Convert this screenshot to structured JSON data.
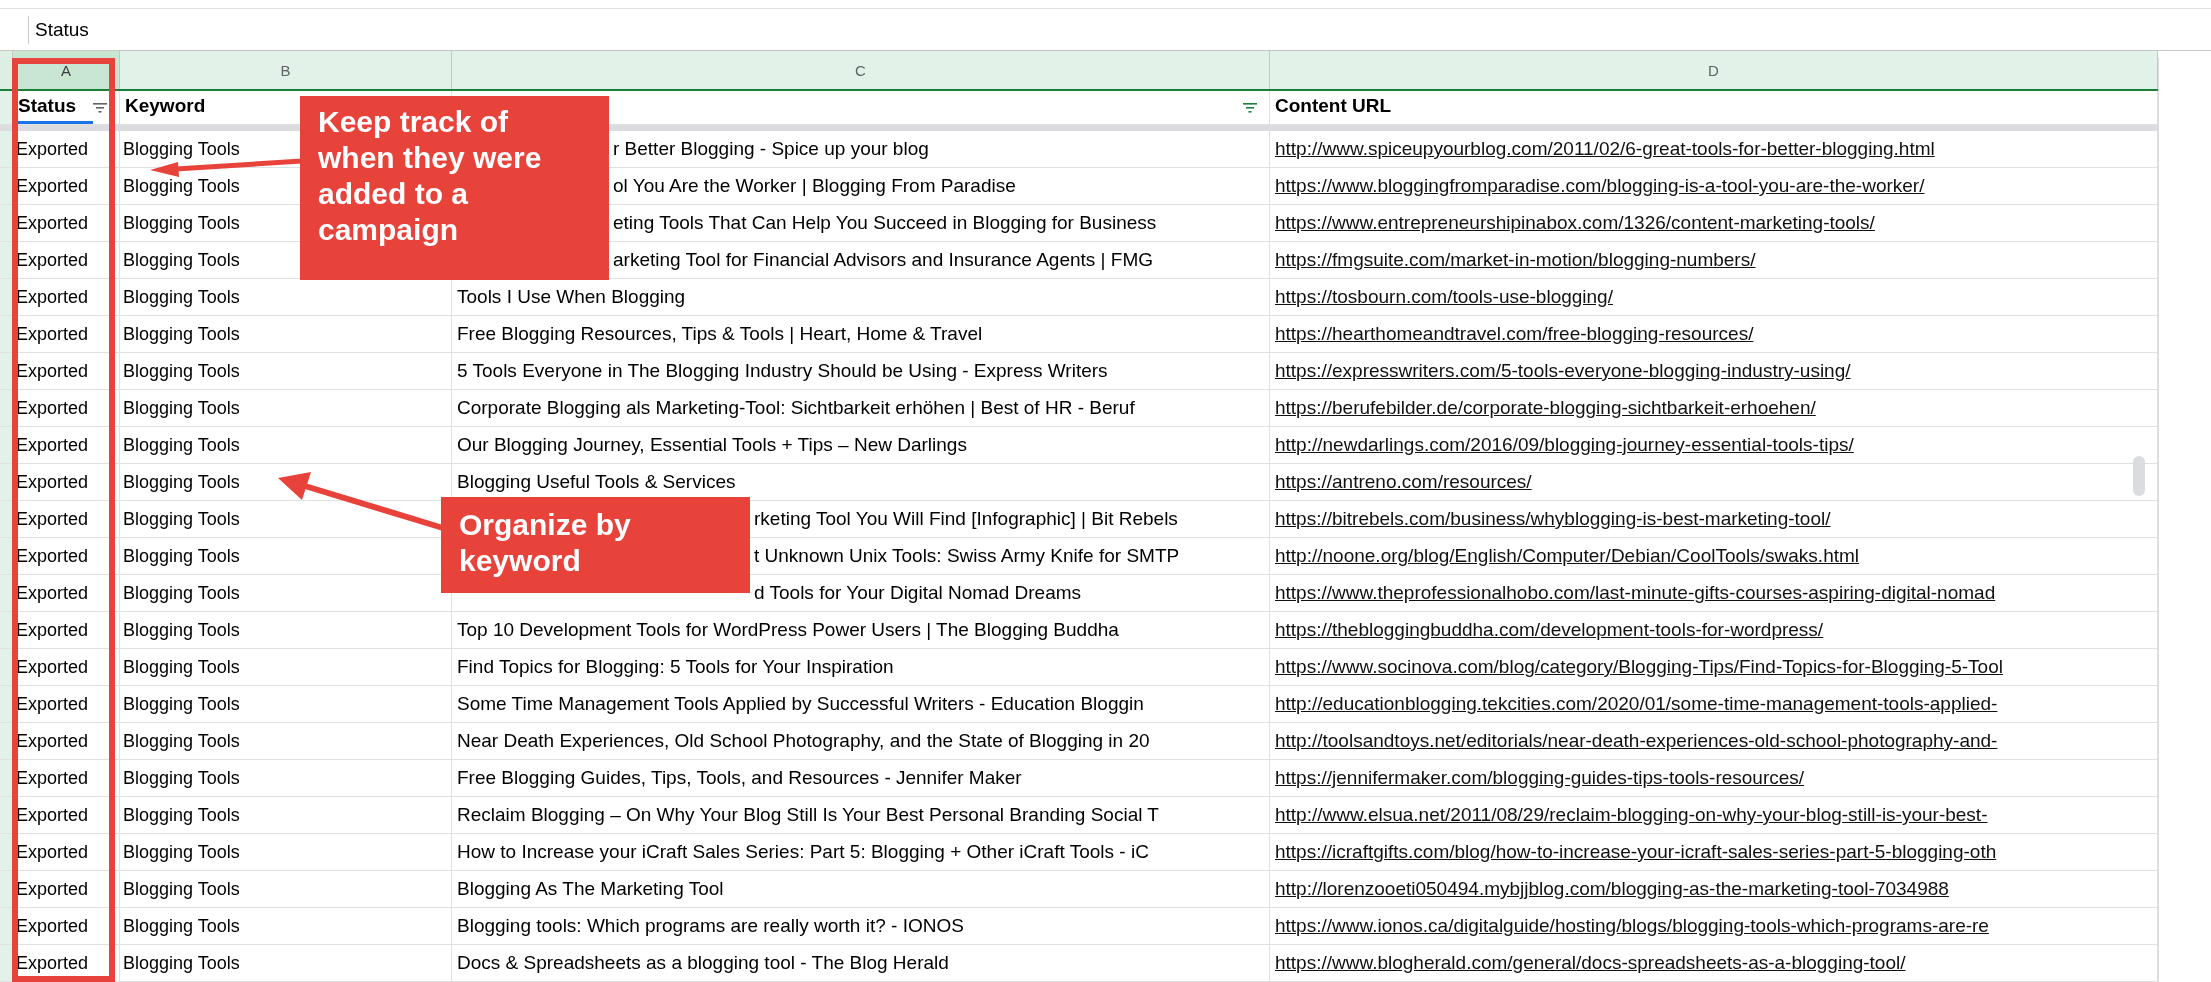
{
  "formula_bar": {
    "value": "Status"
  },
  "columns": [
    {
      "letter": "A",
      "selected": true
    },
    {
      "letter": "B",
      "selected": false
    },
    {
      "letter": "C",
      "selected": false
    },
    {
      "letter": "D",
      "selected": false
    }
  ],
  "header": [
    {
      "text": "Status",
      "filter": true,
      "selected": true
    },
    {
      "text": "Keyword",
      "filter": false,
      "selected": false
    },
    {
      "filter": true,
      "selected": false
    },
    {
      "text": "Content URL",
      "filter": false,
      "selected": false
    }
  ],
  "rows": [
    {
      "status": "Exported",
      "keyword": "Blogging Tools",
      "title": "r Better Blogging - Spice up your blog",
      "title_covered": true,
      "url": "http://www.spiceupyourblog.com/2011/02/6-great-tools-for-better-blogging.html"
    },
    {
      "status": "Exported",
      "keyword": "Blogging Tools",
      "title": "ol You Are the Worker | Blogging From Paradise",
      "title_covered": true,
      "url": "https://www.bloggingfromparadise.com/blogging-is-a-tool-you-are-the-worker/"
    },
    {
      "status": "Exported",
      "keyword": "Blogging Tools",
      "title": "eting Tools That Can Help You Succeed in Blogging for Business",
      "title_covered": true,
      "url": "https://www.entrepreneurshipinabox.com/1326/content-marketing-tools/"
    },
    {
      "status": "Exported",
      "keyword": "Blogging Tools",
      "title": "arketing Tool for Financial Advisors and Insurance Agents | FMG",
      "title_covered": true,
      "url": "https://fmgsuite.com/market-in-motion/blogging-numbers/"
    },
    {
      "status": "Exported",
      "keyword": "Blogging Tools",
      "title": "Tools I Use When Blogging",
      "title_covered": false,
      "url": "https://tosbourn.com/tools-use-blogging/"
    },
    {
      "status": "Exported",
      "keyword": "Blogging Tools",
      "title": "Free Blogging Resources, Tips & Tools | Heart, Home & Travel",
      "title_covered": false,
      "url": "https://hearthomeandtravel.com/free-blogging-resources/"
    },
    {
      "status": "Exported",
      "keyword": "Blogging Tools",
      "title": "5 Tools Everyone in The Blogging Industry Should be Using - Express Writers",
      "title_covered": false,
      "url": "https://expresswriters.com/5-tools-everyone-blogging-industry-using/"
    },
    {
      "status": "Exported",
      "keyword": "Blogging Tools",
      "title": "Corporate Blogging als Marketing-Tool: Sichtbarkeit erhöhen | Best of HR - Beruf",
      "title_covered": false,
      "url": "https://berufebilder.de/corporate-blogging-sichtbarkeit-erhoehen/"
    },
    {
      "status": "Exported",
      "keyword": "Blogging Tools",
      "title": "Our Blogging Journey, Essential Tools + Tips – New Darlings",
      "title_covered": false,
      "url": "http://newdarlings.com/2016/09/blogging-journey-essential-tools-tips/"
    },
    {
      "status": "Exported",
      "keyword": "Blogging Tools",
      "title": "Blogging Useful Tools & Services",
      "title_covered": false,
      "url": "https://antreno.com/resources/"
    },
    {
      "status": "Exported",
      "keyword": "Blogging Tools",
      "title": "rketing Tool You Will Find [Infographic] | Bit Rebels",
      "title_covered": true,
      "url": "https://bitrebels.com/business/whyblogging-is-best-marketing-tool/"
    },
    {
      "status": "Exported",
      "keyword": "Blogging Tools",
      "title": "t Unknown Unix Tools: Swiss Army Knife for SMTP",
      "title_covered": true,
      "url": "http://noone.org/blog/English/Computer/Debian/CoolTools/swaks.html"
    },
    {
      "status": "Exported",
      "keyword": "Blogging Tools",
      "title": "d Tools for Your Digital Nomad Dreams",
      "title_covered": true,
      "url": "https://www.theprofessionalhobo.com/last-minute-gifts-courses-aspiring-digital-nomad"
    },
    {
      "status": "Exported",
      "keyword": "Blogging Tools",
      "title": "Top 10 Development Tools for WordPress Power Users | The Blogging Buddha",
      "title_covered": false,
      "url": "https://thebloggingbuddha.com/development-tools-for-wordpress/"
    },
    {
      "status": "Exported",
      "keyword": "Blogging Tools",
      "title": "Find Topics for Blogging: 5 Tools for Your Inspiration",
      "title_covered": false,
      "url": "https://www.socinova.com/blog/category/Blogging-Tips/Find-Topics-for-Blogging-5-Tool"
    },
    {
      "status": "Exported",
      "keyword": "Blogging Tools",
      "title": "Some Time Management Tools Applied by Successful Writers - Education Bloggin",
      "title_covered": false,
      "url": "http://educationblogging.tekcities.com/2020/01/some-time-management-tools-applied-"
    },
    {
      "status": "Exported",
      "keyword": "Blogging Tools",
      "title": "Near Death Experiences, Old School Photography, and the State of Blogging in 20",
      "title_covered": false,
      "url": "http://toolsandtoys.net/editorials/near-death-experiences-old-school-photography-and-"
    },
    {
      "status": "Exported",
      "keyword": "Blogging Tools",
      "title": "Free Blogging Guides, Tips, Tools, and Resources - Jennifer Maker",
      "title_covered": false,
      "url": "https://jennifermaker.com/blogging-guides-tips-tools-resources/"
    },
    {
      "status": "Exported",
      "keyword": "Blogging Tools",
      "title": "Reclaim Blogging – On Why Your Blog Still Is Your Best Personal Branding Social T",
      "title_covered": false,
      "url": "http://www.elsua.net/2011/08/29/reclaim-blogging-on-why-your-blog-still-is-your-best-"
    },
    {
      "status": "Exported",
      "keyword": "Blogging Tools",
      "title": "How to Increase your iCraft Sales Series: Part 5: Blogging + Other iCraft Tools - iC",
      "title_covered": false,
      "url": "https://icraftgifts.com/blog/how-to-increase-your-icraft-sales-series-part-5-blogging-oth"
    },
    {
      "status": "Exported",
      "keyword": "Blogging Tools",
      "title": "Blogging As The Marketing Tool",
      "title_covered": false,
      "url": "http://lorenzooeti050494.mybjjblog.com/blogging-as-the-marketing-tool-7034988"
    },
    {
      "status": "Exported",
      "keyword": "Blogging Tools",
      "title": "Blogging tools: Which programs are really worth it? - IONOS",
      "title_covered": false,
      "url": "https://www.ionos.ca/digitalguide/hosting/blogs/blogging-tools-which-programs-are-re"
    },
    {
      "status": "Exported",
      "keyword": "Blogging Tools",
      "title": "Docs & Spreadsheets as a blogging tool - The Blog Herald",
      "title_covered": false,
      "url": "https://www.blogherald.com/general/docs-spreadsheets-as-a-blogging-tool/"
    }
  ],
  "callouts": [
    {
      "text": "Keep track of when they were added to a campaign",
      "kind": "first"
    },
    {
      "text": "Organize by keyword",
      "kind": "second"
    }
  ]
}
